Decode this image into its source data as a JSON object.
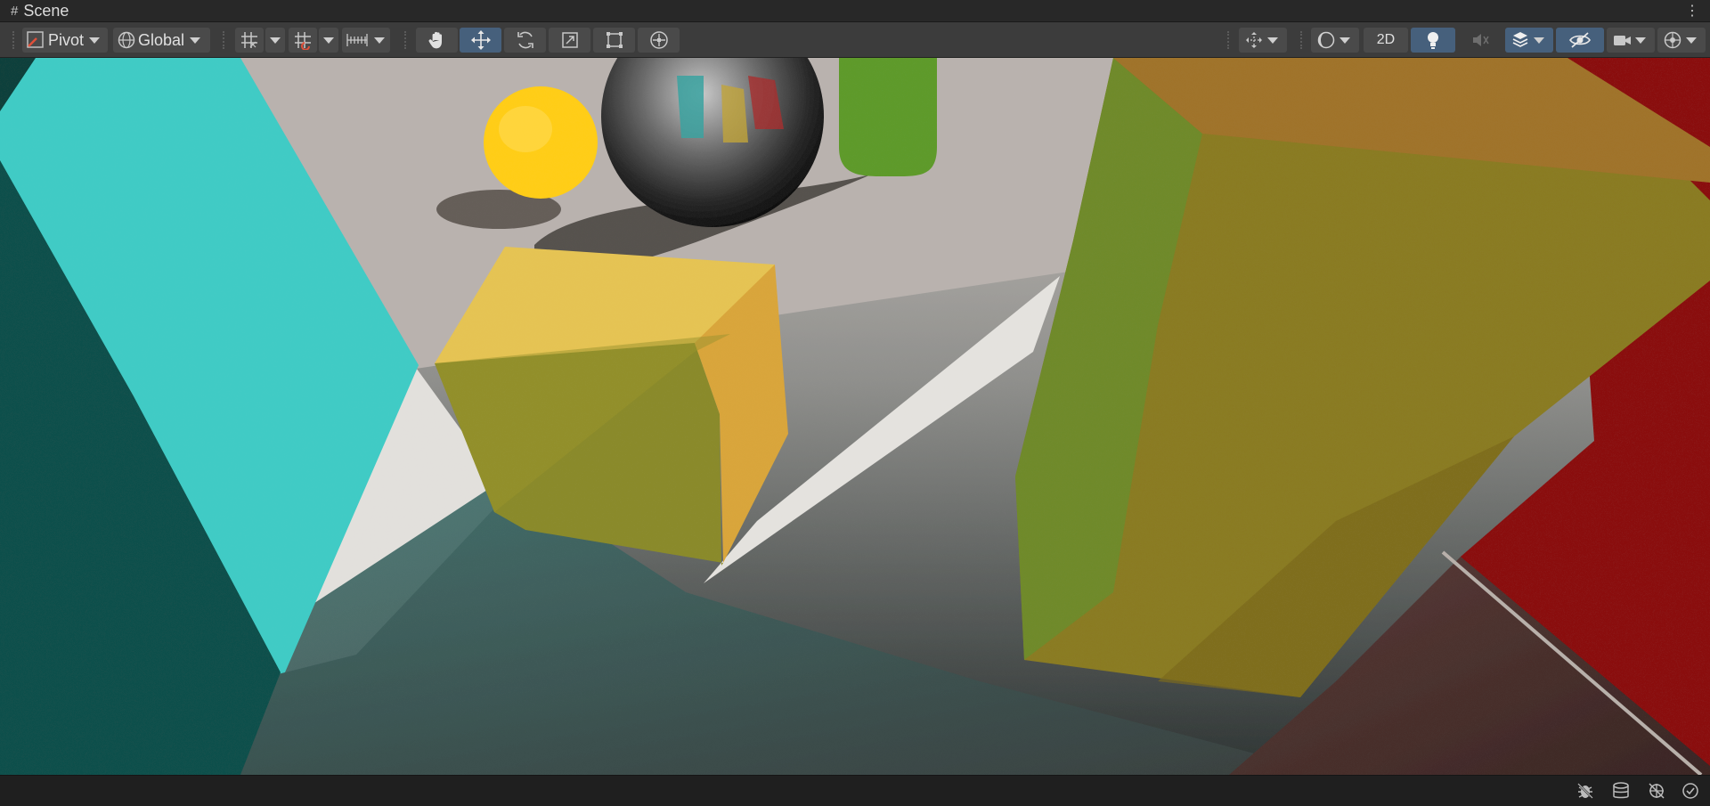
{
  "window": {
    "title": "Scene"
  },
  "toolbar": {
    "pivot_label": "Pivot",
    "global_label": "Global",
    "mode_2d_label": "2D"
  },
  "icons": [
    "grid-icon",
    "pivot-icon",
    "globe-icon",
    "grid-snap-icon",
    "increment-snap-icon",
    "ruler-snap-icon",
    "hand-tool-icon",
    "move-tool-icon",
    "rotate-tool-icon",
    "scale-tool-icon",
    "rect-tool-icon",
    "transform-tool-icon",
    "gizmo-orientation-icon",
    "shading-mode-icon",
    "lighting-icon",
    "audio-icon",
    "effects-icon",
    "hidden-objects-icon",
    "camera-icon",
    "gizmos-icon",
    "bug-icon",
    "layers-icon",
    "gizmo-visibility-icon",
    "check-icon"
  ],
  "colors": {
    "toolbar_bg": "#3c3c3c",
    "button_bg": "#4a4a4a",
    "selected_bg": "#46607c",
    "cyan_wall": "#3ec9c3",
    "yellow_cube": "#e2bf4d",
    "olive_block": "#8a7a22",
    "red_wall": "#8c1010",
    "floor": "#c9c3bd",
    "sphere_light": "#ffcc1a"
  }
}
